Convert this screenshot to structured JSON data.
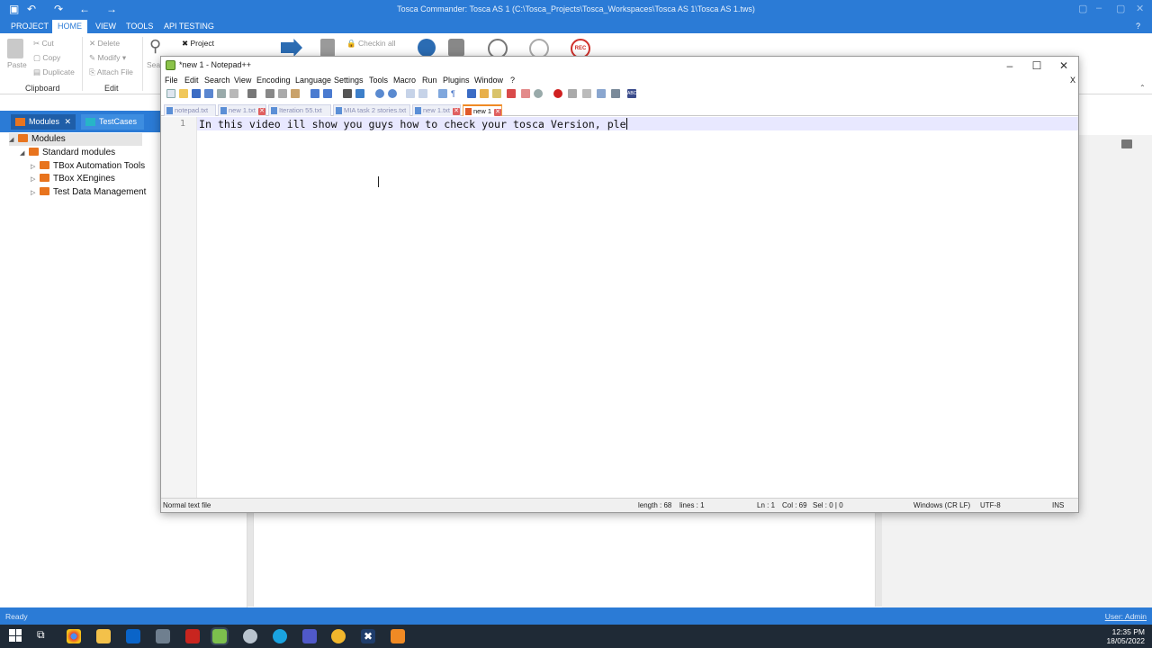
{
  "tosca": {
    "window_title": "Tosca Commander: Tosca AS 1 (C:\\Tosca_Projects\\Tosca_Workspaces\\Tosca AS 1\\Tosca AS 1.tws)",
    "ribbon_tabs": [
      "PROJECT",
      "HOME",
      "VIEW",
      "TOOLS",
      "API TESTING"
    ],
    "ribbon": {
      "paste": "Paste",
      "cut": "Cut",
      "copy": "Copy",
      "duplicate": "Duplicate",
      "delete": "Delete",
      "modify": "Modify",
      "attach_file": "Attach File",
      "search": "Sea",
      "project": "Project",
      "checkin_all": "Checkin all",
      "rec": "REC",
      "group_clipboard": "Clipboard",
      "group_edit": "Edit"
    },
    "help": "?",
    "nav_tabs": [
      "Modules",
      "TestCases"
    ],
    "tree": {
      "root": "Modules",
      "standard": "Standard modules",
      "items": [
        "TBox Automation Tools",
        "TBox XEngines",
        "Test Data Management"
      ]
    },
    "status_left": "Ready",
    "status_right": "User: Admin"
  },
  "notepad": {
    "title": "*new 1 - Notepad++",
    "menu": [
      "File",
      "Edit",
      "Search",
      "View",
      "Encoding",
      "Language",
      "Settings",
      "Tools",
      "Macro",
      "Run",
      "Plugins",
      "Window",
      "?"
    ],
    "close_doc": "X",
    "tabs": [
      "notepad.txt",
      "new 1.txt",
      "Iteration 55.txt",
      "MIA task 2 stories.txt",
      "new 1.txt",
      "new 1"
    ],
    "active_tab_index": 5,
    "line_number": "1",
    "line_text": "In this video ill show you guys how to check your tosca Version, ple",
    "status": {
      "file_type": "Normal text file",
      "length": "length : 68",
      "lines": "lines : 1",
      "ln": "Ln : 1",
      "col": "Col : 69",
      "sel": "Sel : 0 | 0",
      "eol": "Windows (CR LF)",
      "encoding": "UTF-8",
      "mode": "INS"
    }
  },
  "taskbar": {
    "time": "12:35 PM",
    "date": "18/05/2022"
  },
  "colors": {
    "tosca_blue": "#2b7bd6",
    "folder_orange": "#e8741e",
    "taskbar": "#1f2a36",
    "active_tab_orange": "#f08a24"
  }
}
